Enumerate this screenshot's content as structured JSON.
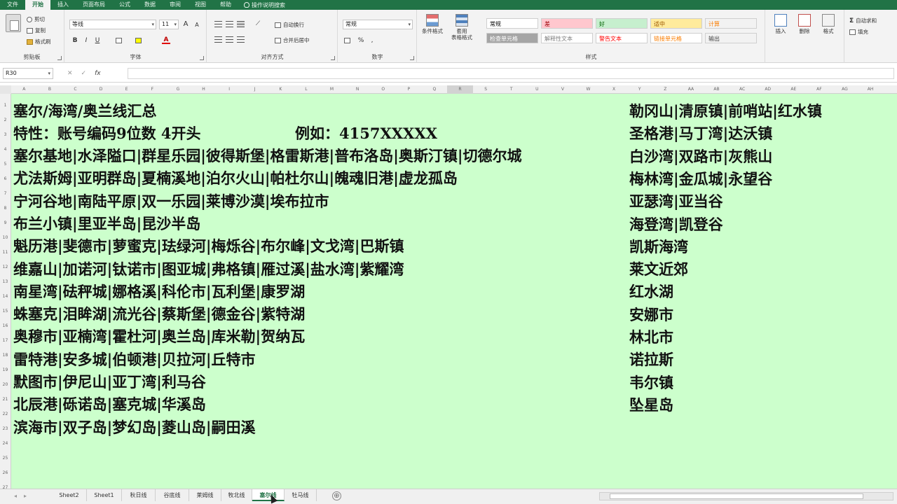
{
  "menu": {
    "tabs": [
      "文件",
      "开始",
      "插入",
      "页面布局",
      "公式",
      "数据",
      "审阅",
      "视图",
      "帮助"
    ],
    "active": "开始",
    "tell_me": "操作说明搜索"
  },
  "ribbon": {
    "clipboard": {
      "cut": "剪切",
      "copy": "复制",
      "format_painter": "格式刷",
      "label": "剪贴板"
    },
    "font": {
      "name": "等线",
      "size": "11",
      "bold": "B",
      "italic": "I",
      "underline": "U",
      "grow": "A",
      "shrink": "A",
      "color_letter": "A",
      "label": "字体"
    },
    "alignment": {
      "wrap": "自动换行",
      "merge": "合并后居中",
      "label": "对齐方式"
    },
    "number": {
      "format": "常规",
      "percent": "%",
      "comma": ",",
      "label": "数字"
    },
    "styles": {
      "conditional": "条件格式",
      "table": "套用\n表格格式",
      "cells": [
        {
          "text": "常规",
          "bg": "#ffffff",
          "fg": "#000000"
        },
        {
          "text": "差",
          "bg": "#ffc7ce",
          "fg": "#9c0006"
        },
        {
          "text": "好",
          "bg": "#c6efce",
          "fg": "#006100"
        },
        {
          "text": "适中",
          "bg": "#ffeb9c",
          "fg": "#9c5700"
        },
        {
          "text": "计算",
          "bg": "#f2f2f2",
          "fg": "#fa7d00"
        },
        {
          "text": "检查单元格",
          "bg": "#a5a5a5",
          "fg": "#ffffff"
        },
        {
          "text": "解释性文本",
          "bg": "#ffffff",
          "fg": "#7f7f7f"
        },
        {
          "text": "警告文本",
          "bg": "#ffffff",
          "fg": "#ff0000"
        },
        {
          "text": "链接单元格",
          "bg": "#ffffff",
          "fg": "#fa7d00"
        },
        {
          "text": "输出",
          "bg": "#f2f2f2",
          "fg": "#3f3f3f"
        }
      ],
      "label": "样式"
    },
    "cells_group": {
      "insert": "插入",
      "delete": "删除",
      "format": "格式"
    },
    "editing": {
      "autosum": "自动求和",
      "fill": "填充"
    }
  },
  "formula_bar": {
    "name_box": "R30",
    "fx": "fx"
  },
  "columns": [
    "A",
    "B",
    "C",
    "D",
    "E",
    "F",
    "G",
    "H",
    "I",
    "J",
    "K",
    "L",
    "M",
    "N",
    "O",
    "P",
    "Q",
    "R",
    "S",
    "T",
    "U",
    "V",
    "W",
    "X",
    "Y",
    "Z",
    "AA",
    "AB",
    "AC",
    "AD",
    "AE",
    "AF",
    "AG",
    "AH"
  ],
  "selected_column": "R",
  "rows": [
    "1",
    "2",
    "3",
    "4",
    "5",
    "6",
    "7",
    "8",
    "9",
    "10",
    "11",
    "12",
    "13",
    "14",
    "15",
    "16",
    "17",
    "18",
    "19",
    "20",
    "21",
    "22",
    "23",
    "24",
    "25",
    "26",
    "27"
  ],
  "content": {
    "title": "塞尔/海湾/奥兰线汇总",
    "feature": "特性：账号编码9位数  4开头",
    "example": "例如：4157XXXXX",
    "left_lines": [
      "塞尔基地|水泽隘口|群星乐园|彼得斯堡|格雷斯港|普布洛岛|奥斯汀镇|切德尔城",
      "尤法斯姆|亚明群岛|夏楠溪地|泊尔火山|帕杜尔山|魄魂旧港|虚龙孤岛",
      "宁河谷地|南陆平原|双一乐园|莱博沙漠|埃布拉市",
      "布兰小镇|里亚半岛|昆沙半岛",
      "魁历港|斐德市|萝蜜克|珐绿河|梅烁谷|布尔峰|文戈湾|巴斯镇",
      "维嘉山|加诺河|钛诺市|图亚城|弗格镇|雁过溪|盐水湾|紫耀湾",
      "南星湾|砝秤城|娜格溪|科伦市|瓦利堡|康罗湖",
      "蛛塞克|泪眸湖|流光谷|蔡斯堡|德金谷|紫特湖",
      "奥穆市|亚楠湾|霍杜河|奥兰岛|库米勒|贺纳瓦",
      "雷特港|安多城|伯顿港|贝拉河|丘特市",
      "默图市|伊尼山|亚丁湾|利马谷",
      "北辰港|砾诺岛|塞克城|华溪岛",
      "滨海市|双子岛|梦幻岛|菱山岛|嗣田溪"
    ],
    "right_lines": [
      "勒冈山|清原镇|前哨站|红水镇",
      "圣格港|马丁湾|达沃镇",
      "白沙湾|双路市|灰熊山",
      "梅林湾|金瓜城|永望谷",
      "亚瑟湾|亚当谷",
      "海登湾|凯登谷",
      "凯斯海湾",
      "莱文近郊",
      "红水湖",
      "安娜市",
      "林北市",
      "诺拉斯",
      "韦尔镇",
      "坠星岛"
    ]
  },
  "sheet_tabs": [
    "Sheet2",
    "Sheet1",
    "秋日线",
    "谷底线",
    "莱姆线",
    "牧北线",
    "塞尔线",
    "牡马线"
  ],
  "active_sheet": "塞尔线",
  "add_sheet": "⊕",
  "colors": {
    "excel_green": "#217346",
    "sheet_bg": "#ccffcc"
  }
}
